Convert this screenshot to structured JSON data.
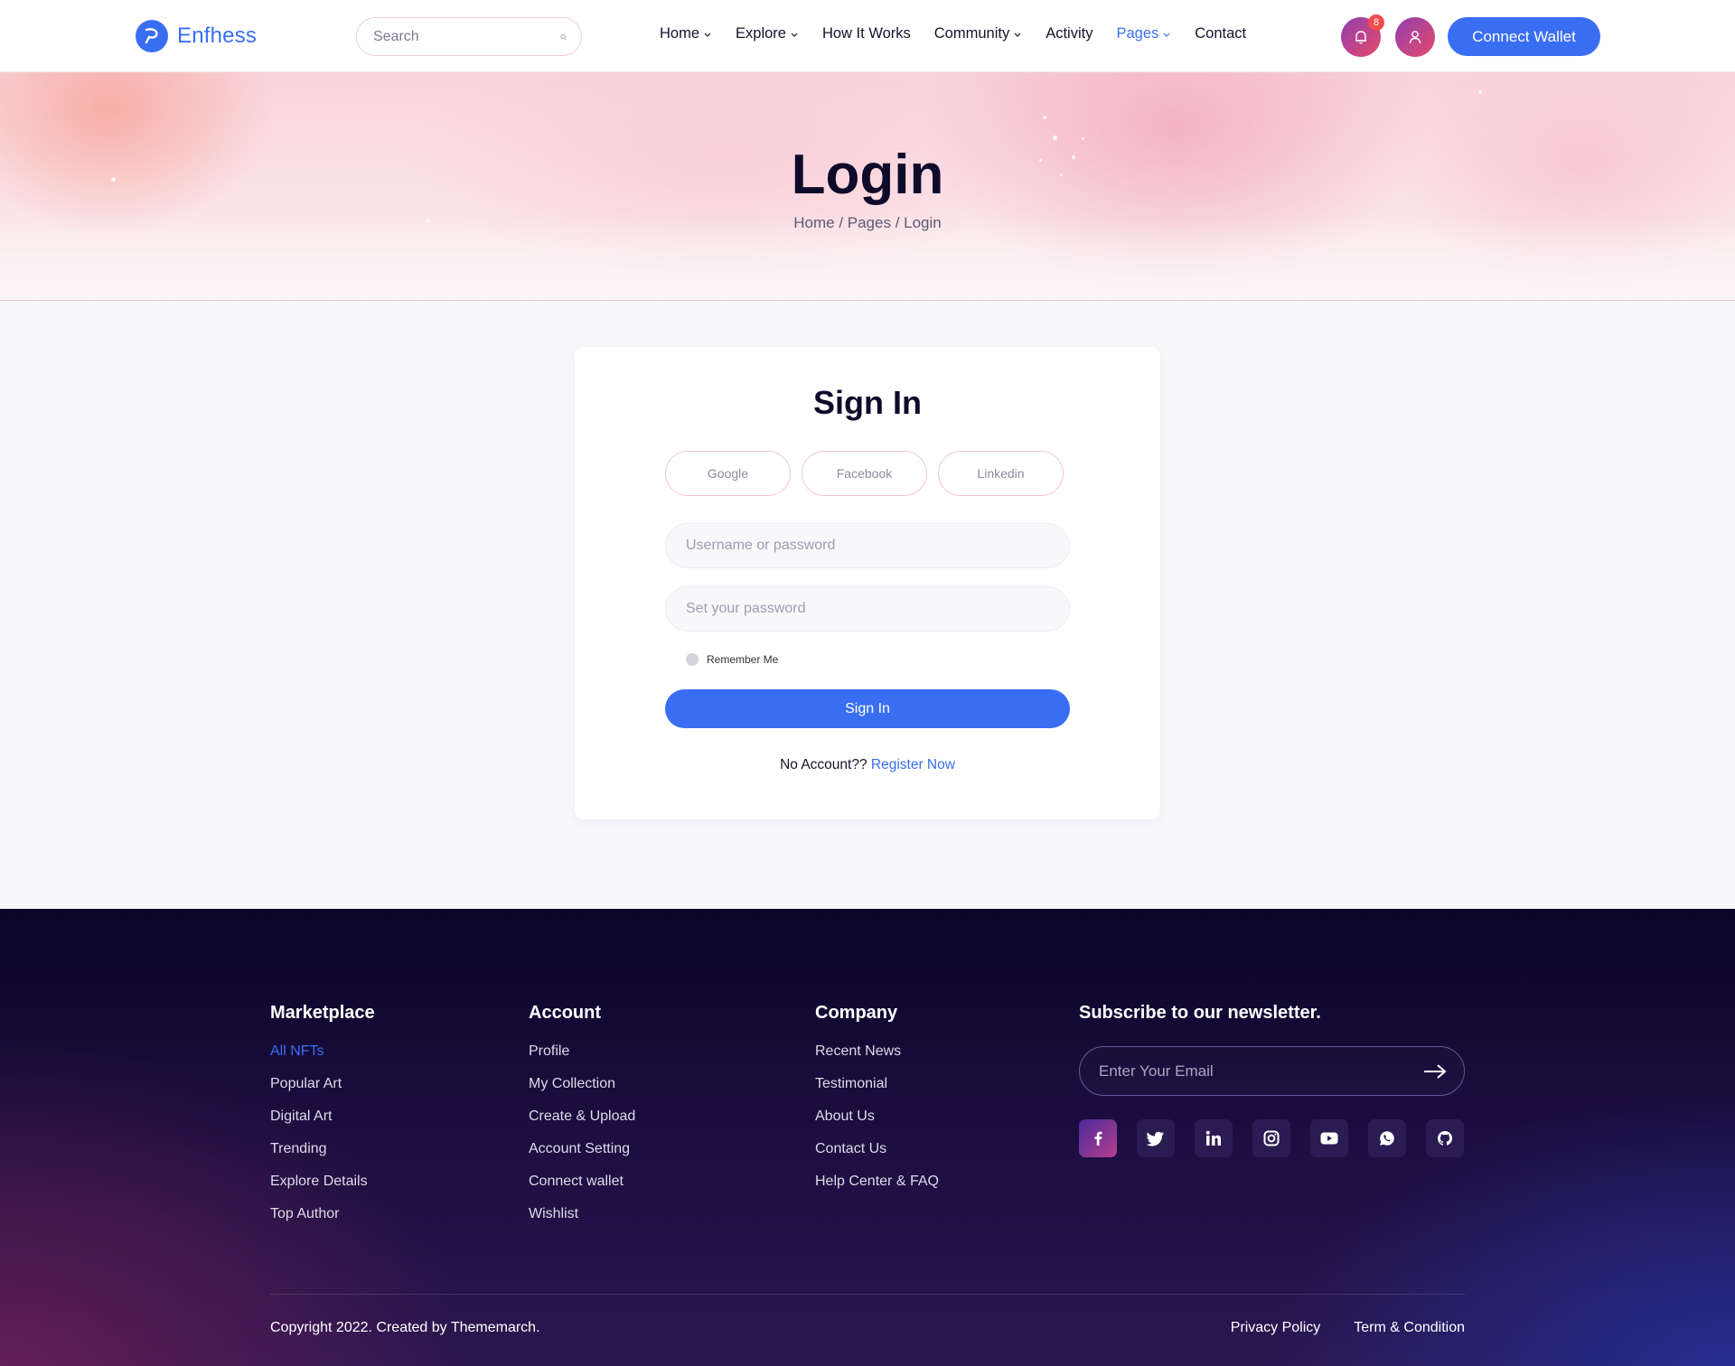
{
  "header": {
    "brand": "Enfhess",
    "search_placeholder": "Search",
    "nav": [
      {
        "label": "Home",
        "dropdown": true
      },
      {
        "label": "Explore",
        "dropdown": true
      },
      {
        "label": "How It Works",
        "dropdown": false
      },
      {
        "label": "Community",
        "dropdown": true
      },
      {
        "label": "Activity",
        "dropdown": false
      },
      {
        "label": "Pages",
        "dropdown": true,
        "active": true
      },
      {
        "label": "Contact",
        "dropdown": false
      }
    ],
    "notification_count": "8",
    "connect_label": "Connect Wallet",
    "accent_color": "#3a6ef2"
  },
  "hero": {
    "title": "Login",
    "breadcrumb": "Home / Pages / Login"
  },
  "login": {
    "title": "Sign In",
    "social": [
      "Google",
      "Facebook",
      "Linkedin"
    ],
    "username_placeholder": "Username or password",
    "password_placeholder": "Set your password",
    "remember_label": "Remember Me",
    "submit_label": "Sign In",
    "no_account_text": "No Account??",
    "register_label": "Register Now"
  },
  "footer": {
    "columns": [
      {
        "title": "Marketplace",
        "links": [
          "All NFTs",
          "Popular Art",
          "Digital Art",
          "Trending",
          "Explore Details",
          "Top Author"
        ]
      },
      {
        "title": "Account",
        "links": [
          "Profile",
          "My Collection",
          "Create & Upload",
          "Account Setting",
          "Connect wallet",
          "Wishlist"
        ]
      },
      {
        "title": "Company",
        "links": [
          "Recent News",
          "Testimonial",
          "About Us",
          "Contact Us",
          "Help Center & FAQ"
        ]
      }
    ],
    "newsletter_title": "Subscribe to our newsletter.",
    "email_placeholder": "Enter Your Email",
    "social_icons": [
      "facebook-icon",
      "twitter-icon",
      "linkedin-icon",
      "instagram-icon",
      "youtube-icon",
      "whatsapp-icon",
      "github-icon"
    ],
    "copyright": "Copyright 2022. Created by Thememarch.",
    "privacy_label": "Privacy Policy",
    "terms_label": "Term & Condition"
  }
}
